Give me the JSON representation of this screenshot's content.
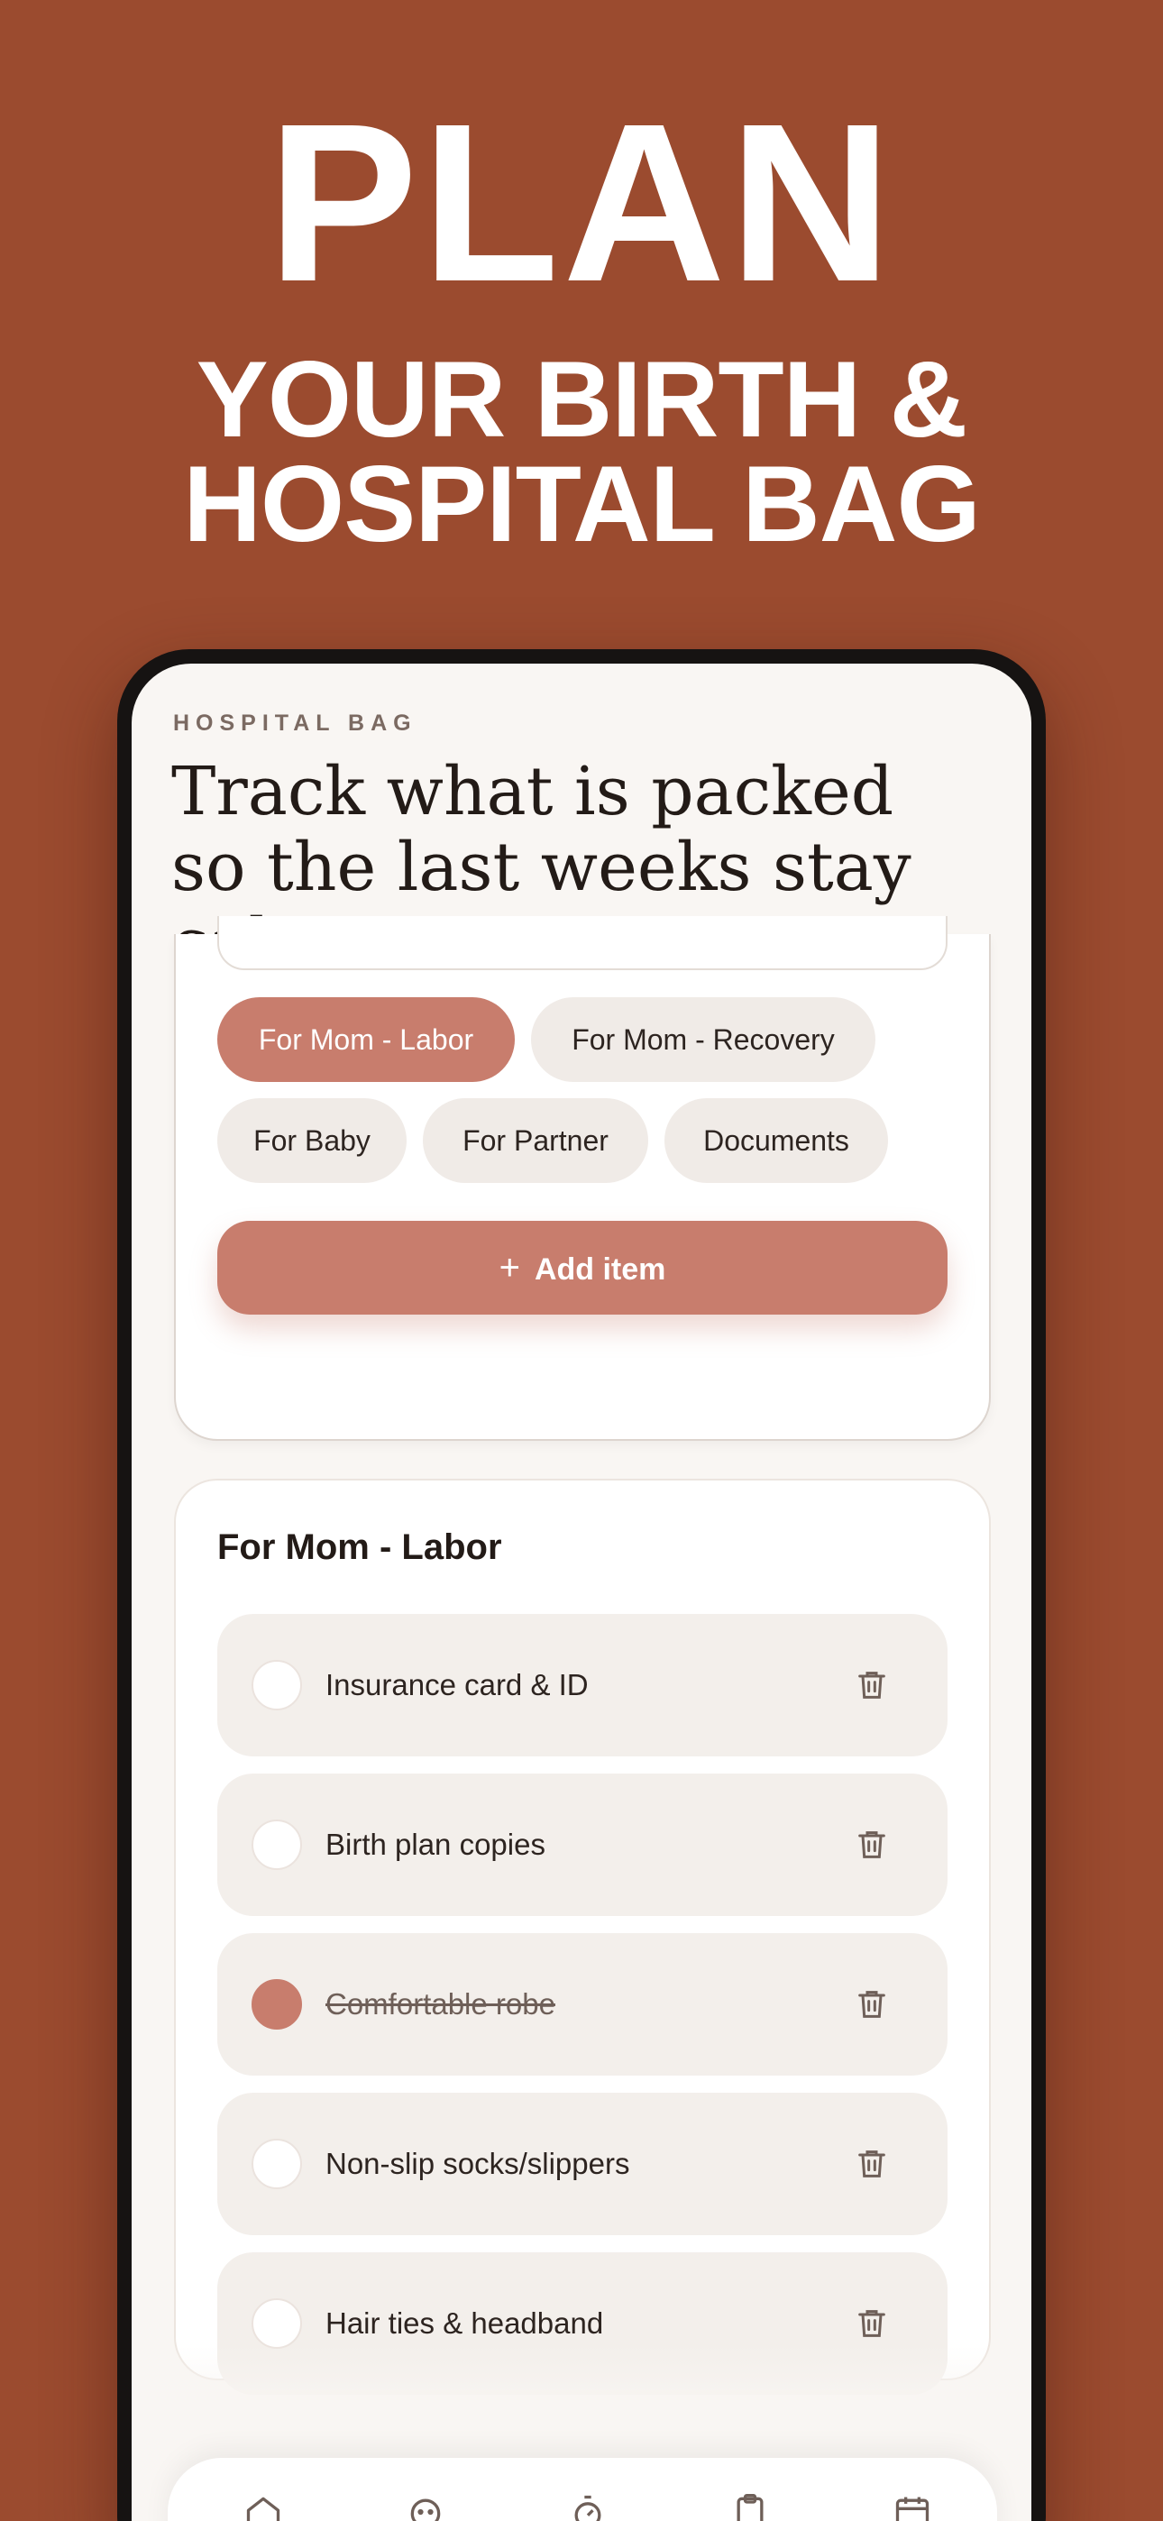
{
  "hero": {
    "title": "PLAN",
    "subtitle_line1": "YOUR BIRTH &",
    "subtitle_line2": "HOSPITAL BAG"
  },
  "screen": {
    "eyebrow": "HOSPITAL BAG",
    "headline": "Track what is packed so the last weeks stay calmer."
  },
  "categories": [
    {
      "label": "For Mom - Labor",
      "active": true
    },
    {
      "label": "For Mom - Recovery",
      "active": false
    },
    {
      "label": "For Baby",
      "active": false
    },
    {
      "label": "For Partner",
      "active": false
    },
    {
      "label": "Documents",
      "active": false
    }
  ],
  "add_button": {
    "icon": "plus-icon",
    "label": "Add item"
  },
  "section": {
    "title": "For Mom - Labor",
    "items": [
      {
        "label": "Insurance card & ID",
        "packed": false
      },
      {
        "label": "Birth plan copies",
        "packed": false
      },
      {
        "label": "Comfortable robe",
        "packed": true
      },
      {
        "label": "Non-slip socks/slippers",
        "packed": false
      },
      {
        "label": "Hair ties & headband",
        "packed": false
      }
    ]
  },
  "tabbar": {
    "icons": [
      "home-icon",
      "baby-face-icon",
      "timer-icon",
      "clipboard-icon",
      "calendar-icon"
    ]
  },
  "colors": {
    "background": "#9b4b2f",
    "accent": "#c87d6d",
    "surface": "#f9f6f3"
  }
}
